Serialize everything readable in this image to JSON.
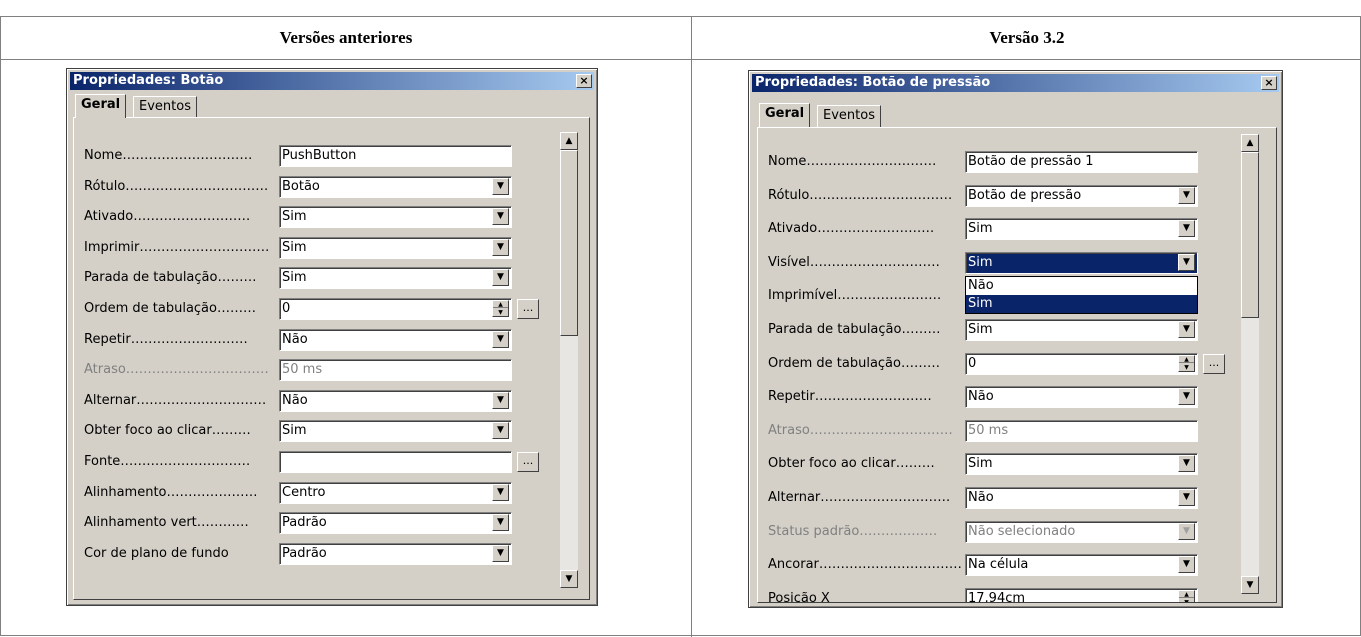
{
  "columns": {
    "left_title": "Versões anteriores",
    "right_title": "Versão 3.2"
  },
  "left_dialog": {
    "title": "Propriedades: Botão",
    "close_glyph": "×",
    "tabs": [
      "Geral",
      "Eventos"
    ],
    "rows": [
      {
        "label": "Nome…………………………",
        "value": "PushButton",
        "control": "text"
      },
      {
        "label": "Rótulo……………………………",
        "value": "Botão",
        "control": "dropdown"
      },
      {
        "label": "Ativado………………………",
        "value": "Sim",
        "control": "dropdown"
      },
      {
        "label": "Imprimir…………………………",
        "value": "Sim",
        "control": "dropdown"
      },
      {
        "label": "Parada de tabulação………",
        "value": "Sim",
        "control": "dropdown"
      },
      {
        "label": "Ordem de tabulação………",
        "value": "0",
        "control": "spin_ellipsis"
      },
      {
        "label": "Repetir………………………",
        "value": "Não",
        "control": "dropdown"
      },
      {
        "label": "Atraso……………………………",
        "value": "50 ms",
        "control": "text_disabled"
      },
      {
        "label": "Alternar…………………………",
        "value": "Não",
        "control": "dropdown"
      },
      {
        "label": "Obter foco ao clicar………",
        "value": "Sim",
        "control": "dropdown"
      },
      {
        "label": "Fonte…………………………",
        "value": "",
        "control": "text_ellipsis"
      },
      {
        "label": "Alinhamento…………………",
        "value": "Centro",
        "control": "dropdown"
      },
      {
        "label": "Alinhamento vert…………",
        "value": "Padrão",
        "control": "dropdown"
      },
      {
        "label": "Cor de plano de fundo",
        "value": "Padrão",
        "control": "dropdown_partial"
      }
    ]
  },
  "right_dialog": {
    "title": "Propriedades: Botão de pressão",
    "close_glyph": "×",
    "tabs": [
      "Geral",
      "Eventos"
    ],
    "rows": [
      {
        "label": "Nome…………………………",
        "value": "Botão de pressão 1",
        "control": "text"
      },
      {
        "label": "Rótulo……………………………",
        "value": "Botão de pressão",
        "control": "dropdown"
      },
      {
        "label": "Ativado………………………",
        "value": "Sim",
        "control": "dropdown"
      },
      {
        "label": "Visível…………………………",
        "value": "Sim",
        "control": "dropdown_open"
      },
      {
        "label": "Imprimível……………………",
        "value": "",
        "control": "hidden"
      },
      {
        "label": "Parada de tabulação………",
        "value": "Sim",
        "control": "dropdown"
      },
      {
        "label": "Ordem de tabulação………",
        "value": "0",
        "control": "spin_ellipsis"
      },
      {
        "label": "Repetir………………………",
        "value": "Não",
        "control": "dropdown"
      },
      {
        "label": "Atraso……………………………",
        "value": "50 ms",
        "control": "text_disabled"
      },
      {
        "label": "Obter foco ao clicar………",
        "value": "Sim",
        "control": "dropdown"
      },
      {
        "label": "Alternar…………………………",
        "value": "Não",
        "control": "dropdown"
      },
      {
        "label": "Status padrão………………",
        "value": "Não selecionado",
        "control": "dropdown_disabled"
      },
      {
        "label": "Ancorar……………………………",
        "value": "Na célula",
        "control": "dropdown"
      },
      {
        "label": "Posição X",
        "value": "17,94cm",
        "control": "spin_partial"
      }
    ],
    "open_list": [
      "Não",
      "Sim"
    ],
    "open_list_selected": "Sim"
  },
  "icons": {
    "dropdown_arrow": "▼",
    "spin_up": "▲",
    "spin_down": "▼",
    "ellipsis": "...",
    "scroll_up": "▲",
    "scroll_down": "▼"
  }
}
